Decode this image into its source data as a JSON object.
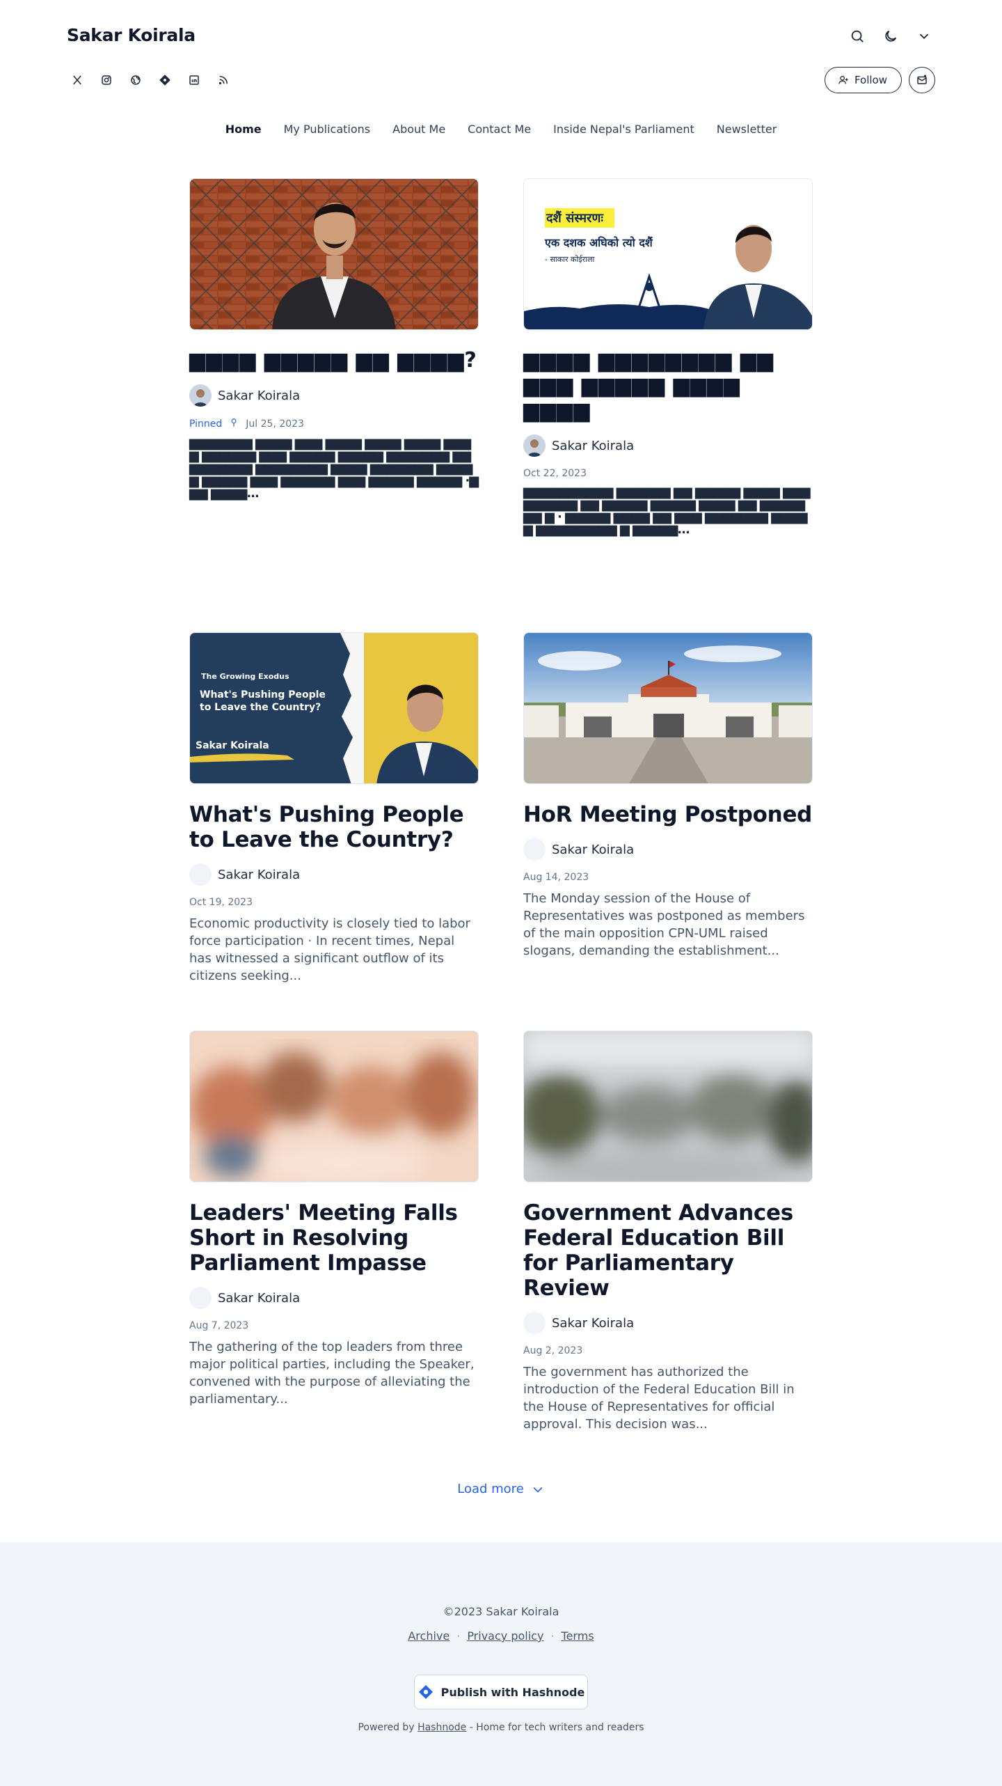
{
  "brand": "Sakar Koirala",
  "icons": {
    "search": "search-icon",
    "theme": "moon-icon",
    "menu": "chevron-down-icon",
    "socials": [
      "x-icon",
      "instagram-icon",
      "globe-icon",
      "hashnode-icon",
      "linkedin-icon",
      "rss-icon"
    ]
  },
  "header": {
    "follow_label": "Follow"
  },
  "nav": [
    {
      "label": "Home",
      "active": true
    },
    {
      "label": "My Publications",
      "active": false
    },
    {
      "label": "About Me",
      "active": false
    },
    {
      "label": "Contact Me",
      "active": false
    },
    {
      "label": "Inside Nepal's Parliament",
      "active": false
    },
    {
      "label": "Newsletter",
      "active": false
    }
  ],
  "posts": [
    {
      "title": "▆▆▆▆ ▆▆▆▆▆ ▆▆ ▆▆▆▆?",
      "author": "Sakar Koirala",
      "pinned_label": "Pinned",
      "date": "Jul 25, 2023",
      "excerpt": "▆▆▆▆▆▆▆ ▆▆▆▆ ▆▆▆ ▆▆▆▆ ▆▆▆▆ ▆▆▆▆ ▆▆▆▆ ▆▆▆▆▆▆ ▆▆▆ ▆▆▆▆▆ ▆▆▆▆▆ ▆▆▆▆▆▆▆ ▆▆▆▆▆▆▆▆▆ ▆▆▆▆▆▆▆▆ ▆▆▆▆ ▆▆▆▆▆▆▆ ▆▆▆▆▆ ▆▆▆▆▆ ▆▆▆ ▆▆▆▆▆▆ ▆▆▆ ▆▆▆▆▆ ▆▆▆▆▆ ·▆▆▆ ▆▆▆▆..."
    },
    {
      "title": "▆▆▆▆ ▆▆▆▆▆▆▆▆ ▆▆ ▆▆▆ ▆▆▆▆▆ ▆▆▆▆ ▆▆▆▆",
      "author": "Sakar Koirala",
      "date": "Oct 22, 2023",
      "excerpt": "▆▆▆▆▆▆▆▆▆▆ ▆▆▆▆▆▆ ▆▆ ▆▆▆▆▆ ▆▆▆▆ ▆▆▆ ▆▆▆▆▆▆ ▆▆ ▆▆▆▆▆ ▆▆▆▆▆ ▆▆▆▆ ▆▆ ▆▆▆▆▆ ▆▆ ▆ · ▆▆▆▆▆ ▆▆▆▆ ▆▆ ▆▆▆ ▆▆▆▆▆▆▆ ▆▆▆▆▆ ▆▆▆▆▆▆▆▆▆ ▆ ▆▆▆▆▆..."
    },
    {
      "title": "What's Pushing People to Leave the Country?",
      "author": "Sakar Koirala",
      "date": "Oct 19, 2023",
      "excerpt": "Economic productivity is closely tied to labor force participation · In recent times, Nepal has witnessed a significant outflow of its citizens seeking..."
    },
    {
      "title": "HoR Meeting Postponed",
      "author": "Sakar Koirala",
      "date": "Aug 14, 2023",
      "excerpt": "The Monday session of the House of Representatives was postponed as members of the main opposition CPN-UML raised slogans, demanding the establishment..."
    },
    {
      "title": "Leaders' Meeting Falls Short in Resolving Parliament Impasse",
      "author": "Sakar Koirala",
      "date": "Aug 7, 2023",
      "excerpt": "The gathering of the top leaders from three major political parties, including the Speaker, convened with the purpose of alleviating the parliamentary..."
    },
    {
      "title": "Government Advances Federal Education Bill for Parliamentary Review",
      "author": "Sakar Koirala",
      "date": "Aug 2, 2023",
      "excerpt": "The government has authorized the introduction of the Federal Education Bill in the House of Representatives for official approval. This decision was..."
    }
  ],
  "thumbs": {
    "post2": {
      "heading": "दशैं संस्मरणः",
      "line": "एक दशक अघिको  त्यो दशैं",
      "byline": "- साकार कोईराला"
    },
    "post3": {
      "kicker": "The Growing Exodus",
      "headline": "What's Pushing People to Leave the Country?",
      "name": "Sakar Koirala"
    }
  },
  "load_more_label": "Load more",
  "footer": {
    "copyright": "©2023 Sakar Koirala",
    "links": [
      "Archive",
      "Privacy policy",
      "Terms"
    ],
    "publish_label": "Publish with Hashnode",
    "powered_prefix": "Powered by",
    "powered_link": "Hashnode",
    "powered_suffix": "- Home for tech writers and readers"
  },
  "colors": {
    "accent": "#2563eb",
    "text": "#0f172a",
    "muted": "#64748b",
    "footer_bg": "#f1f5f9",
    "thumb_navy": "#1f3a5a",
    "thumb_yellow": "#e8c640"
  }
}
